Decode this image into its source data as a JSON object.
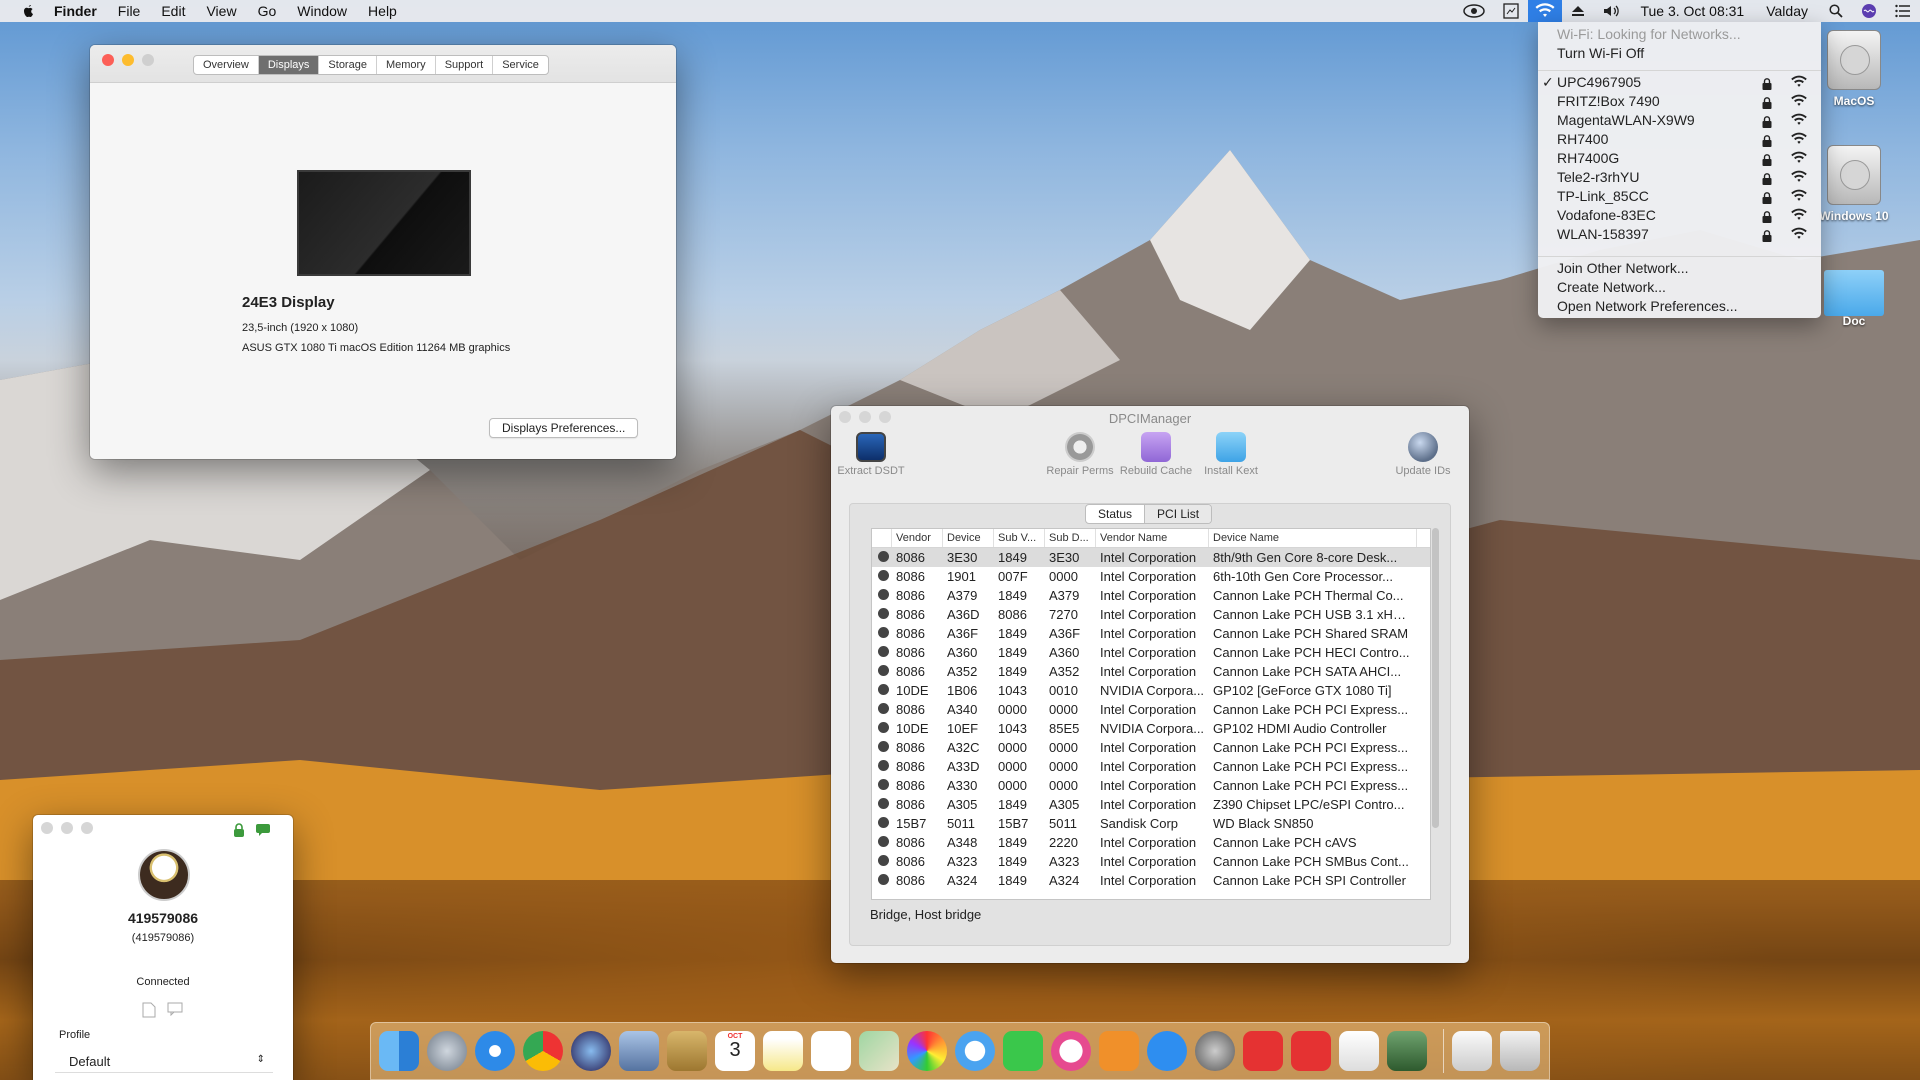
{
  "menubar": {
    "app_name": "Finder",
    "menus": [
      "File",
      "Edit",
      "View",
      "Go",
      "Window",
      "Help"
    ],
    "clock": "Tue 3. Oct  08:31",
    "user": "Valday"
  },
  "about_window": {
    "tabs": [
      "Overview",
      "Displays",
      "Storage",
      "Memory",
      "Support",
      "Service"
    ],
    "active_tab": "Displays",
    "display_name": "24E3 Display",
    "display_size": "23,5-inch (1920 x 1080)",
    "graphics": "ASUS GTX 1080 Ti macOS Edition 11264 MB graphics",
    "prefs_button": "Displays Preferences..."
  },
  "wifi_menu": {
    "status": "Wi-Fi: Looking for Networks...",
    "toggle": "Turn Wi-Fi Off",
    "networks": [
      "UPC4967905",
      "FRITZ!Box 7490",
      "MagentaWLAN-X9W9",
      "RH7400",
      "RH7400G",
      "Tele2-r3rhYU",
      "TP-Link_85CC",
      "Vodafone-83EC",
      "WLAN-158397"
    ],
    "selected_network": "UPC4967905",
    "actions": [
      "Join Other Network...",
      "Create Network...",
      "Open Network Preferences..."
    ]
  },
  "desktop_icons": [
    "MacOS",
    "Windows 10",
    "Doc"
  ],
  "dpci": {
    "title": "DPCIManager",
    "toolbar": [
      "Extract DSDT",
      "Repair Perms",
      "Rebuild Cache",
      "Install Kext",
      "Update IDs"
    ],
    "tabs": [
      "Status",
      "PCI List"
    ],
    "columns": [
      "Vendor",
      "Device",
      "Sub V...",
      "Sub D...",
      "Vendor Name",
      "Device Name"
    ],
    "rows": [
      [
        "8086",
        "3E30",
        "1849",
        "3E30",
        "Intel Corporation",
        "8th/9th Gen Core 8-core Desk..."
      ],
      [
        "8086",
        "1901",
        "007F",
        "0000",
        "Intel Corporation",
        "6th-10th Gen Core Processor..."
      ],
      [
        "8086",
        "A379",
        "1849",
        "A379",
        "Intel Corporation",
        "Cannon Lake PCH Thermal Co..."
      ],
      [
        "8086",
        "A36D",
        "8086",
        "7270",
        "Intel Corporation",
        "Cannon Lake PCH USB 3.1 xHC..."
      ],
      [
        "8086",
        "A36F",
        "1849",
        "A36F",
        "Intel Corporation",
        "Cannon Lake PCH Shared SRAM"
      ],
      [
        "8086",
        "A360",
        "1849",
        "A360",
        "Intel Corporation",
        "Cannon Lake PCH HECI Contro..."
      ],
      [
        "8086",
        "A352",
        "1849",
        "A352",
        "Intel Corporation",
        "Cannon Lake PCH SATA AHCI..."
      ],
      [
        "10DE",
        "1B06",
        "1043",
        "0010",
        "NVIDIA Corpora...",
        "GP102 [GeForce GTX 1080 Ti]"
      ],
      [
        "8086",
        "A340",
        "0000",
        "0000",
        "Intel Corporation",
        "Cannon Lake PCH PCI Express..."
      ],
      [
        "10DE",
        "10EF",
        "1043",
        "85E5",
        "NVIDIA Corpora...",
        "GP102 HDMI Audio Controller"
      ],
      [
        "8086",
        "A32C",
        "0000",
        "0000",
        "Intel Corporation",
        "Cannon Lake PCH PCI Express..."
      ],
      [
        "8086",
        "A33D",
        "0000",
        "0000",
        "Intel Corporation",
        "Cannon Lake PCH PCI Express..."
      ],
      [
        "8086",
        "A330",
        "0000",
        "0000",
        "Intel Corporation",
        "Cannon Lake PCH PCI Express..."
      ],
      [
        "8086",
        "A305",
        "1849",
        "A305",
        "Intel Corporation",
        "Z390 Chipset LPC/eSPI Contro..."
      ],
      [
        "15B7",
        "5011",
        "15B7",
        "5011",
        "Sandisk Corp",
        "WD Black SN850"
      ],
      [
        "8086",
        "A348",
        "1849",
        "2220",
        "Intel Corporation",
        "Cannon Lake PCH cAVS"
      ],
      [
        "8086",
        "A323",
        "1849",
        "A323",
        "Intel Corporation",
        "Cannon Lake PCH SMBus Cont..."
      ],
      [
        "8086",
        "A324",
        "1849",
        "A324",
        "Intel Corporation",
        "Cannon Lake PCH SPI Controller"
      ]
    ],
    "status_text": "Bridge, Host bridge"
  },
  "teamviewer": {
    "id": "419579086",
    "id_paren": "(419579086)",
    "status": "Connected",
    "profile_label": "Profile",
    "profile_value": "Default"
  },
  "dock_apps": [
    "Finder",
    "Launchpad",
    "Safari",
    "Chrome",
    "Siri",
    "Preview",
    "Notefile",
    "Calendar",
    "Notes",
    "Reminders",
    "Maps",
    "Photos",
    "Messages",
    "FaceTime",
    "iTunes",
    "iBooks",
    "App Store",
    "System Preferences",
    "AnyDesk",
    "AnyDesk 2",
    "TextEdit",
    "Network Utility",
    "Documents",
    "Trash"
  ],
  "calendar_day": "3",
  "calendar_month": "OCT"
}
